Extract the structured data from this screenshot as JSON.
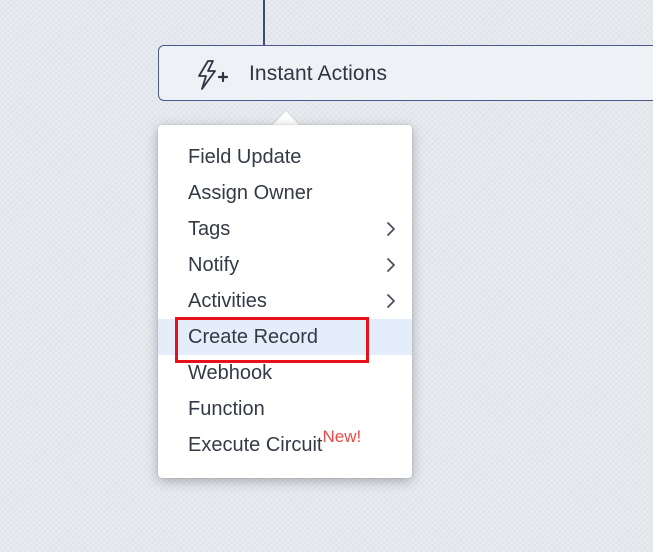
{
  "action_bar": {
    "title": "Instant Actions",
    "icon": "lightning-plus-icon"
  },
  "menu": {
    "items": [
      {
        "label": "Field Update",
        "submenu": false
      },
      {
        "label": "Assign Owner",
        "submenu": false
      },
      {
        "label": "Tags",
        "submenu": true
      },
      {
        "label": "Notify",
        "submenu": true
      },
      {
        "label": "Activities",
        "submenu": true
      },
      {
        "label": "Create Record",
        "submenu": false,
        "highlighted": true
      },
      {
        "label": "Webhook",
        "submenu": false
      },
      {
        "label": "Function",
        "submenu": false
      },
      {
        "label": "Execute Circuit",
        "submenu": false,
        "badge": "New!"
      }
    ]
  },
  "colors": {
    "badge": "#ef4a4a",
    "highlight_outline": "#e8101a",
    "hover_row": "#e4eefa"
  }
}
